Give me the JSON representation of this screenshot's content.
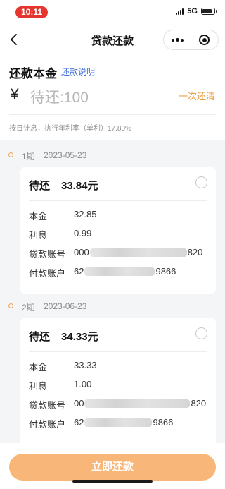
{
  "status_bar": {
    "time": "10:11",
    "network": "5G",
    "battery_level": 0.8
  },
  "nav": {
    "title": "贷款还款"
  },
  "repay": {
    "principal_title": "还款本金",
    "explain_link": "还款说明",
    "currency_symbol": "¥",
    "amount_placeholder": "待还:100",
    "pay_all_link": "一次还清",
    "interest_note": "按日计息，执行年利率（单利）17.80%"
  },
  "installments": [
    {
      "period": "1期",
      "date": "2023-05-23",
      "due_label": "待还",
      "due_amount": "33.84元",
      "rows": [
        {
          "label": "本金",
          "value": "32.85"
        },
        {
          "label": "利息",
          "value": "0.99"
        }
      ],
      "loan_account": {
        "label": "贷款账号",
        "prefix": "000",
        "suffix": "820"
      },
      "pay_account": {
        "label": "付款账户",
        "prefix": "62",
        "suffix": "9866"
      }
    },
    {
      "period": "2期",
      "date": "2023-06-23",
      "due_label": "待还",
      "due_amount": "34.33元",
      "rows": [
        {
          "label": "本金",
          "value": "33.33"
        },
        {
          "label": "利息",
          "value": "1.00"
        }
      ],
      "loan_account": {
        "label": "贷款账号",
        "prefix": "00",
        "suffix": "820"
      },
      "pay_account": {
        "label": "付款账户",
        "prefix": "62",
        "suffix": "9866"
      }
    }
  ],
  "footer": {
    "pay_button": "立即还款"
  },
  "colors": {
    "accent": "#f8b778",
    "link": "#3b6fd8",
    "status_pill": "#e4362f",
    "timeline": "#f0a55a"
  }
}
